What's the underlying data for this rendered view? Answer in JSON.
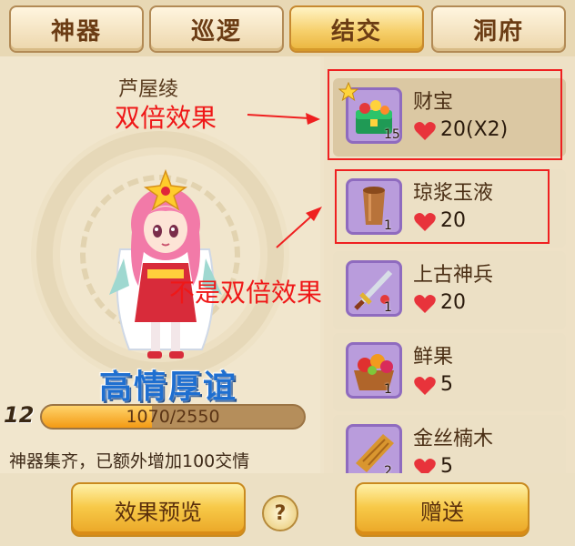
{
  "tabs": [
    {
      "label": "神器"
    },
    {
      "label": "巡逻"
    },
    {
      "label": "结交"
    },
    {
      "label": "洞府"
    }
  ],
  "character": {
    "name": "芦屋绫",
    "relation_title": "高情厚谊",
    "level": "12",
    "xp_text": "1070/2550",
    "xp_progress": 0.42,
    "bonus_text": "神器集齐，已额外增加100交情"
  },
  "gifts": [
    {
      "name": "财宝",
      "count": "15",
      "value": "20(X2)",
      "icon": "treasure-chest-icon",
      "selected": true
    },
    {
      "name": "琼浆玉液",
      "count": "1",
      "value": "20",
      "icon": "wooden-cup-icon",
      "selected": false
    },
    {
      "name": "上古神兵",
      "count": "1",
      "value": "20",
      "icon": "sword-icon",
      "selected": false
    },
    {
      "name": "鲜果",
      "count": "1",
      "value": "5",
      "icon": "fruit-basket-icon",
      "selected": false
    },
    {
      "name": "金丝楠木",
      "count": "2",
      "value": "5",
      "icon": "wood-plank-icon",
      "selected": false
    }
  ],
  "buttons": {
    "preview": "效果预览",
    "help": "?",
    "give": "赠送"
  },
  "annotations": {
    "double_label": "双倍效果",
    "not_double_label": "不是双倍效果",
    "color": "#ef2020"
  },
  "colors": {
    "active_tab": "#f6cf6a",
    "xp_fill": "#f39a14",
    "relation_title": "#1f6fd0"
  }
}
